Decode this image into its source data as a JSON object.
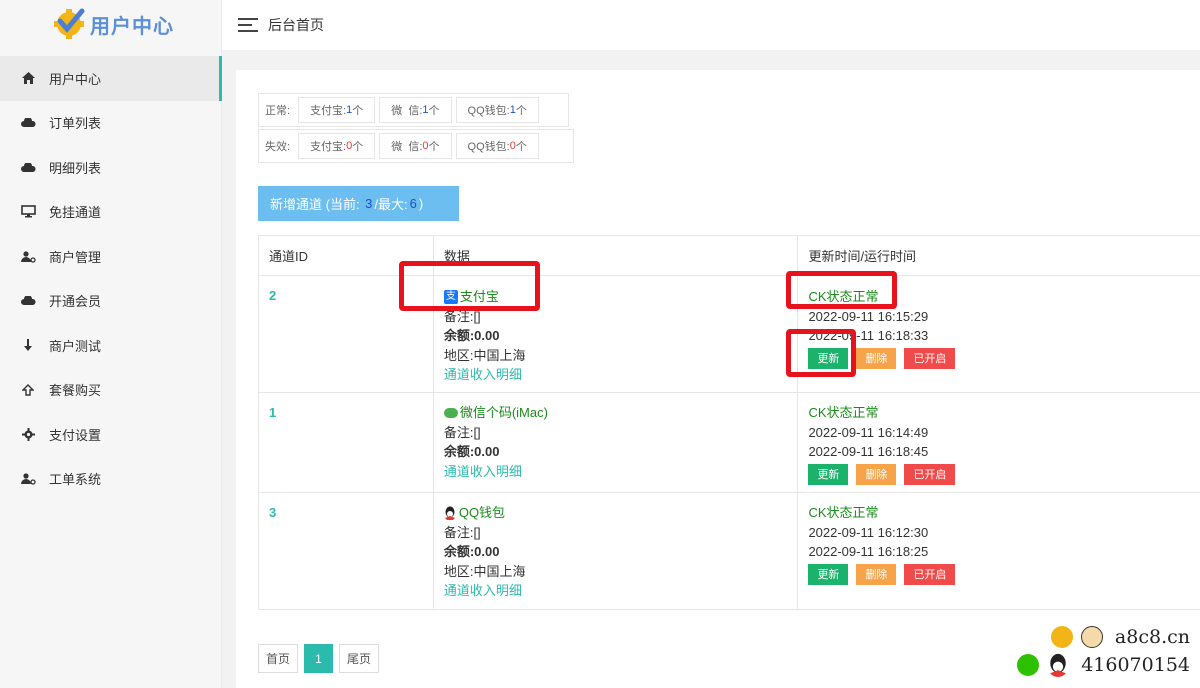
{
  "brand": {
    "title": "用户中心"
  },
  "sidebar": {
    "items": [
      {
        "label": "用户中心",
        "icon": "home-icon",
        "active": true
      },
      {
        "label": "订单列表",
        "icon": "cloud-icon"
      },
      {
        "label": "明细列表",
        "icon": "cloud-icon"
      },
      {
        "label": "免挂通道",
        "icon": "monitor-icon"
      },
      {
        "label": "商户管理",
        "icon": "user-gear-icon"
      },
      {
        "label": "开通会员",
        "icon": "cloud-icon"
      },
      {
        "label": "商户测试",
        "icon": "arrow-down-icon"
      },
      {
        "label": "套餐购买",
        "icon": "arrow-up-icon"
      },
      {
        "label": "支付设置",
        "icon": "gear-icon"
      },
      {
        "label": "工单系统",
        "icon": "user-gear-icon"
      }
    ]
  },
  "header": {
    "title": "后台首页"
  },
  "stats": {
    "normal": {
      "label": "正常:",
      "chips": [
        {
          "name": "支付宝:",
          "count": "1",
          "unit": "个"
        },
        {
          "name": "微  信:",
          "count": "1",
          "unit": "个"
        },
        {
          "name": "QQ钱包:",
          "count": "1",
          "unit": "个"
        }
      ]
    },
    "failed": {
      "label": "失效:",
      "chips": [
        {
          "name": "支付宝:",
          "count": "0",
          "unit": "个"
        },
        {
          "name": "微  信:",
          "count": "0",
          "unit": "个"
        },
        {
          "name": "QQ钱包:",
          "count": "0",
          "unit": "个"
        }
      ]
    }
  },
  "add_channel": {
    "prefix": "新增通道 (当前: ",
    "current": "3",
    "sep": "/最大: ",
    "max": "6",
    "suffix": ")"
  },
  "table": {
    "headers": [
      "通道ID",
      "数据",
      "更新时间/运行时间"
    ],
    "rows": [
      {
        "id": "2",
        "channel": "支付宝",
        "channel_icon": "alipay-icon",
        "note": "备注:[]",
        "balance": "余额:0.00",
        "region": "地区:中国上海",
        "detail_link": "通道收入明细",
        "status": "CK状态正常",
        "updated": "2022-09-11 16:15:29",
        "running": "2022-09-11 16:18:33",
        "btn_update": "更新",
        "btn_delete": "删除",
        "btn_toggle": "已开启"
      },
      {
        "id": "1",
        "channel": "微信个码(iMac)",
        "channel_icon": "wechat-icon",
        "note": "备注:[]",
        "balance": "余额:0.00",
        "region": "",
        "detail_link": "通道收入明细",
        "status": "CK状态正常",
        "updated": "2022-09-11 16:14:49",
        "running": "2022-09-11 16:18:45",
        "btn_update": "更新",
        "btn_delete": "删除",
        "btn_toggle": "已开启"
      },
      {
        "id": "3",
        "channel": "QQ钱包",
        "channel_icon": "qq-icon",
        "note": "备注:[]",
        "balance": "余额:0.00",
        "region": "地区:中国上海",
        "detail_link": "通道收入明细",
        "status": "CK状态正常",
        "updated": "2022-09-11 16:12:30",
        "running": "2022-09-11 16:18:25",
        "btn_update": "更新",
        "btn_delete": "删除",
        "btn_toggle": "已开启"
      }
    ]
  },
  "pagination": {
    "first": "首页",
    "current": "1",
    "last": "尾页"
  },
  "watermark": {
    "site": "a8c8.cn",
    "qq": "416070154"
  }
}
